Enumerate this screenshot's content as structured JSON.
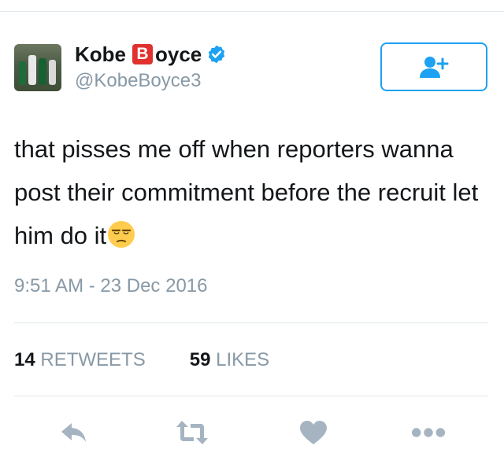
{
  "user": {
    "name_part1": "Kobe",
    "name_emoji": "B",
    "name_part2": "oyce",
    "handle": "@KobeBoyce3"
  },
  "tweet": {
    "text": "that pisses me off when reporters wanna post their commitment before the recruit let him do it",
    "emoji": "unamused-face",
    "timestamp": "9:51 AM - 23 Dec 2016"
  },
  "stats": {
    "retweets_count": "14",
    "retweets_label": "RETWEETS",
    "likes_count": "59",
    "likes_label": "LIKES"
  },
  "icons": {
    "follow": "add-user-icon",
    "verified": "verified-badge-icon",
    "reply": "reply-icon",
    "retweet": "retweet-icon",
    "like": "heart-icon",
    "more": "more-icon"
  },
  "colors": {
    "accent": "#1da1f2",
    "muted": "#8899a6",
    "action_icon": "#a6b4c2",
    "divider": "#e1e8ed"
  }
}
